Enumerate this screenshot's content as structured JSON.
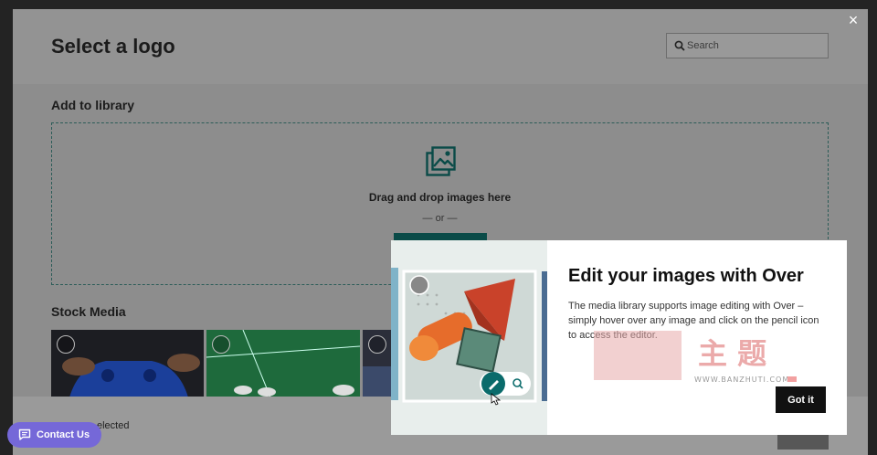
{
  "window": {
    "close_glyph": "×"
  },
  "modal": {
    "title": "Select a logo",
    "search": {
      "placeholder": "Search",
      "value": ""
    },
    "add_library": {
      "title": "Add to library",
      "drop_text": "Drag and drop images here",
      "or_text": "— or —",
      "upload_icon": "image-upload-icon"
    },
    "stock_media": {
      "title": "Stock Media",
      "thumbnails": [
        {
          "subject": "game controller"
        },
        {
          "subject": "soccer field"
        },
        {
          "subject": "stadium"
        }
      ]
    },
    "footer": {
      "selected_text": "elected"
    }
  },
  "contact": {
    "label": "Contact Us",
    "icon": "chat-icon"
  },
  "popover": {
    "title": "Edit your images with Over",
    "body": "The media library supports image editing with Over – simply hover over any image and click on the pencil icon to access the editor.",
    "got_it": "Got it"
  },
  "watermark": {
    "cn_text": "主 题",
    "url": "WWW.BANZHUTI.COM"
  },
  "colors": {
    "accent_teal": "#0a4b48",
    "contact_purple": "#7568d8",
    "overlay": "#8d8d8d"
  }
}
